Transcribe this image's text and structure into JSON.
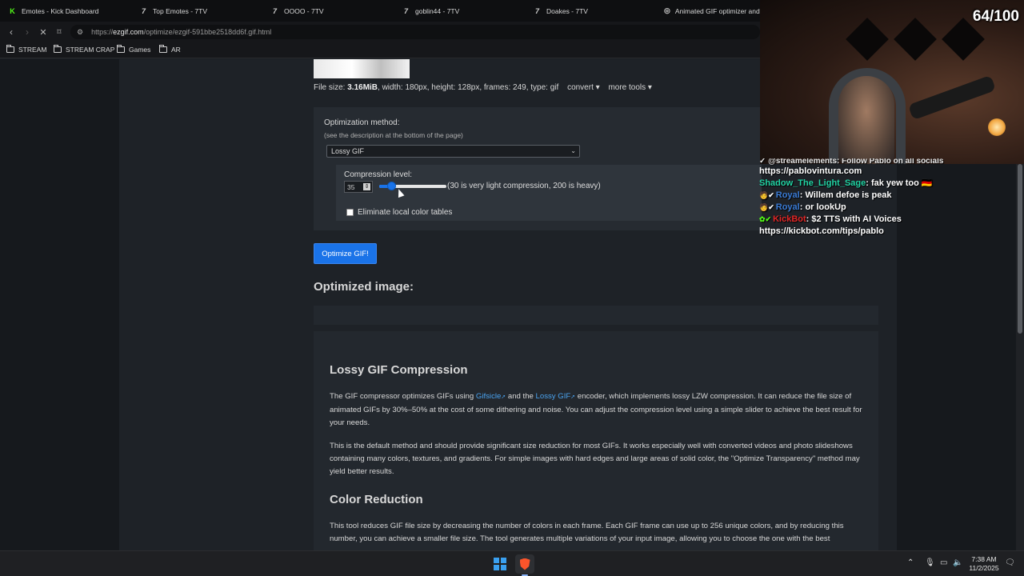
{
  "tabs": [
    {
      "label": "Emotes - Kick Dashboard",
      "icon": "kick-icon"
    },
    {
      "label": "Top Emotes - 7TV",
      "icon": "7tv-icon"
    },
    {
      "label": "OOOO - 7TV",
      "icon": "7tv-icon"
    },
    {
      "label": "goblin44 - 7TV",
      "icon": "7tv-icon"
    },
    {
      "label": "Doakes - 7TV",
      "icon": "7tv-icon"
    },
    {
      "label": "Animated GIF optimizer and c",
      "icon": "ezgif-icon"
    }
  ],
  "address": {
    "scheme": "https://",
    "domain": "ezgif.com",
    "path": "/optimize/ezgif-591bbe2518dd6f.gif.html"
  },
  "bookmarks": [
    "STREAM",
    "STREAM CRAP",
    "Games",
    "AR"
  ],
  "file_info": {
    "prefix": "File size: ",
    "size": "3.16MiB",
    "details": ", width: 180px, height: 128px, frames: 249, type: gif",
    "convert_label": "convert ▾",
    "more_tools_label": "more tools ▾"
  },
  "optimize": {
    "method_label": "Optimization method:",
    "method_hint": "(see the description at the bottom of the page)",
    "method_selected": "Lossy GIF",
    "compression_label": "Compression level:",
    "compression_value": "35",
    "compression_min": 0,
    "compression_max": 200,
    "compression_hint": "(30 is very light compression, 200 is heavy)",
    "eliminate_label": "Eliminate local color tables",
    "button_label": "Optimize GIF!"
  },
  "optimized_title": "Optimized image:",
  "article": {
    "h_lossy": "Lossy GIF Compression",
    "p1_a": "The GIF compressor optimizes GIFs using ",
    "p1_link1": "Gifsicle",
    "p1_b": " and the ",
    "p1_link2": "Lossy GIF",
    "p1_c": " encoder, which implements lossy LZW compression. It can reduce the file size of animated GIFs by 30%–50% at the cost of some dithering and noise. You can adjust the compression level using a simple slider to achieve the best result for your needs.",
    "p2": "This is the default method and should provide significant size reduction for most GIFs. It works especially well with converted videos and photo slideshows containing many colors, textures, and gradients. For simple images with hard edges and large areas of solid color, the \"Optimize Transparency\" method may yield better results.",
    "h_color": "Color Reduction",
    "p3": "This tool reduces GIF file size by decreasing the number of colors in each frame. Each GIF frame can use up to 256 unique colors, and by reducing this number, you can achieve a smaller file size. The tool generates multiple variations of your input image, allowing you to choose the one with the best"
  },
  "overlay": {
    "counter": "64/100",
    "chat_cut": "✓ @streamelements: Follow Pablo on all socials",
    "chat": [
      {
        "user": "",
        "text": "https://pablovintura.com"
      },
      {
        "user": "Shadow_The_Light_Sage",
        "text": ": fak yew too 🇩🇪"
      },
      {
        "user": "Royal",
        "text": ": Willem defoe is peak"
      },
      {
        "user": "Royal",
        "text": ": or lookUp"
      },
      {
        "user": "KickBot",
        "text": ": $2 TTS with AI Voices"
      },
      {
        "user": "",
        "text": "https://kickbot.com/tips/pablo"
      }
    ]
  },
  "taskbar": {
    "time": "7:38 AM",
    "date": "11/2/2025"
  }
}
